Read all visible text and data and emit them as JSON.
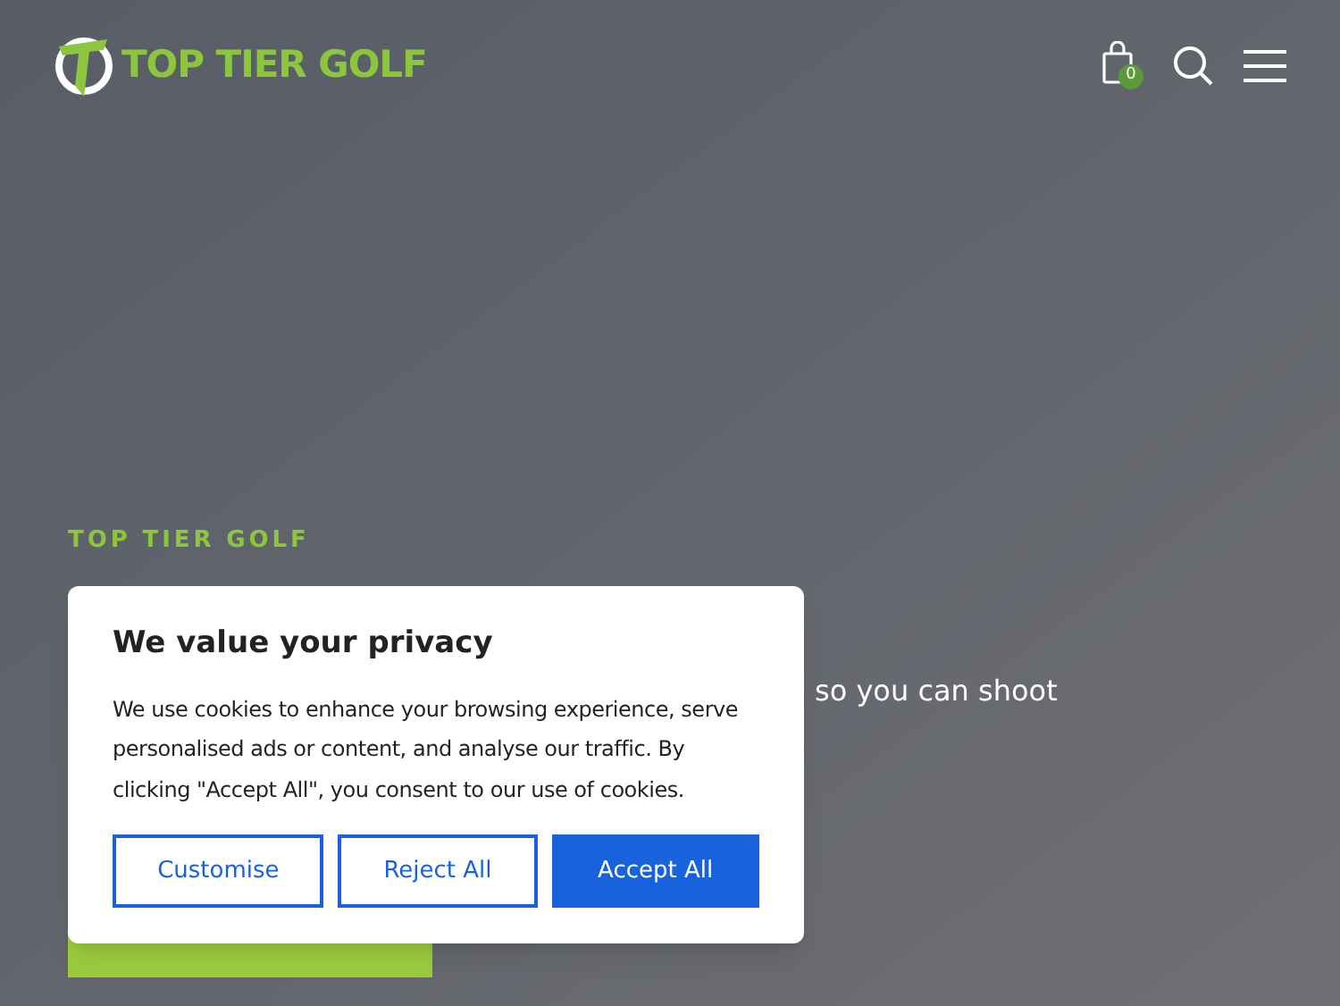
{
  "header": {
    "logo_text": "TOP TIER GOLF",
    "cart_count": "0"
  },
  "hero": {
    "eyebrow": "TOP TIER GOLF",
    "text_fragment": "so you can shoot"
  },
  "cookie_dialog": {
    "title": "We value your privacy",
    "body": "We use cookies to enhance your browsing experience, serve personalised ads or content, and analyse our traffic. By clicking \"Accept All\", you consent to our use of cookies.",
    "buttons": [
      {
        "label": "Customise",
        "kind": "outline"
      },
      {
        "label": "Reject All",
        "kind": "outline"
      },
      {
        "label": "Accept All",
        "kind": "primary"
      }
    ]
  }
}
